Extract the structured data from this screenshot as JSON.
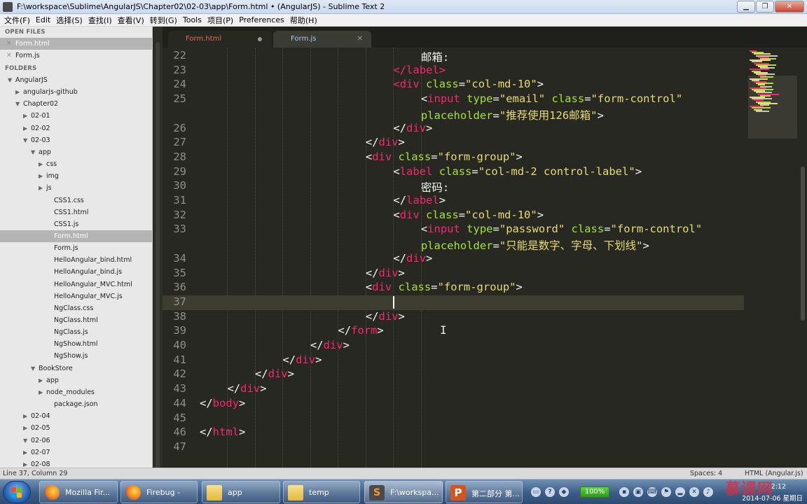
{
  "window": {
    "title": "F:\\workspace\\Sublime\\AngularJS\\Chapter02\\02-03\\app\\Form.html • (AngularJS) - Sublime Text 2",
    "min_label": "▁",
    "max_label": "❐",
    "close_label": "✕"
  },
  "menu": [
    "文件(F)",
    "Edit",
    "选择(S)",
    "查找(I)",
    "查看(V)",
    "转到(G)",
    "Tools",
    "项目(P)",
    "Preferences",
    "帮助(H)"
  ],
  "sidebar": {
    "open_files_header": "OPEN FILES",
    "open_files": [
      {
        "label": "Form.html",
        "selected": true
      },
      {
        "label": "Form.js",
        "selected": false
      }
    ],
    "folders_header": "FOLDERS",
    "tree": [
      {
        "label": "AngularJS",
        "depth": 0,
        "arrow": "▼"
      },
      {
        "label": "angularjs-github",
        "depth": 1,
        "arrow": "▶"
      },
      {
        "label": "Chapter02",
        "depth": 1,
        "arrow": "▼"
      },
      {
        "label": "02-01",
        "depth": 2,
        "arrow": "▶"
      },
      {
        "label": "02-02",
        "depth": 2,
        "arrow": "▶"
      },
      {
        "label": "02-03",
        "depth": 2,
        "arrow": "▼"
      },
      {
        "label": "app",
        "depth": 3,
        "arrow": "▼"
      },
      {
        "label": "css",
        "depth": 4,
        "arrow": "▶"
      },
      {
        "label": "img",
        "depth": 4,
        "arrow": "▶"
      },
      {
        "label": "js",
        "depth": 4,
        "arrow": "▶"
      },
      {
        "label": "CSS1.css",
        "depth": 5,
        "arrow": ""
      },
      {
        "label": "CSS1.html",
        "depth": 5,
        "arrow": ""
      },
      {
        "label": "CSS1.js",
        "depth": 5,
        "arrow": ""
      },
      {
        "label": "Form.html",
        "depth": 5,
        "arrow": "",
        "selected": true
      },
      {
        "label": "Form.js",
        "depth": 5,
        "arrow": ""
      },
      {
        "label": "HelloAngular_bind.html",
        "depth": 5,
        "arrow": ""
      },
      {
        "label": "HelloAngular_bind.js",
        "depth": 5,
        "arrow": ""
      },
      {
        "label": "HelloAngular_MVC.html",
        "depth": 5,
        "arrow": ""
      },
      {
        "label": "HelloAngular_MVC.js",
        "depth": 5,
        "arrow": ""
      },
      {
        "label": "NgClass.css",
        "depth": 5,
        "arrow": ""
      },
      {
        "label": "NgClass.html",
        "depth": 5,
        "arrow": ""
      },
      {
        "label": "NgClass.js",
        "depth": 5,
        "arrow": ""
      },
      {
        "label": "NgShow.html",
        "depth": 5,
        "arrow": ""
      },
      {
        "label": "NgShow.js",
        "depth": 5,
        "arrow": ""
      },
      {
        "label": "BookStore",
        "depth": 3,
        "arrow": "▼"
      },
      {
        "label": "app",
        "depth": 4,
        "arrow": "▶"
      },
      {
        "label": "node_modules",
        "depth": 4,
        "arrow": "▶"
      },
      {
        "label": "package.json",
        "depth": 5,
        "arrow": ""
      },
      {
        "label": "02-04",
        "depth": 2,
        "arrow": "▶"
      },
      {
        "label": "02-05",
        "depth": 2,
        "arrow": "▶"
      },
      {
        "label": "02-06",
        "depth": 2,
        "arrow": "▼"
      },
      {
        "label": "02-07",
        "depth": 2,
        "arrow": "▶"
      },
      {
        "label": "02-08",
        "depth": 2,
        "arrow": "▶"
      }
    ]
  },
  "tabs": [
    {
      "label": "Form.html",
      "active": true,
      "dirty": true
    },
    {
      "label": "Form.js",
      "active": false,
      "dirty": false
    }
  ],
  "editor": {
    "current_line": 37,
    "lines": [
      {
        "num": "22",
        "indent": 8,
        "tokens": [
          [
            "t",
            "邮箱:"
          ]
        ]
      },
      {
        "num": "23",
        "indent": 7,
        "tokens": [
          [
            "g",
            "</"
          ],
          [
            "g",
            "label"
          ],
          [
            "g",
            ">"
          ]
        ]
      },
      {
        "num": "24",
        "indent": 7,
        "tokens": [
          [
            "g",
            "<"
          ],
          [
            "g",
            "div"
          ],
          [
            "a",
            " class"
          ],
          [
            "t",
            "="
          ],
          [
            "s",
            "\"col-md-10\""
          ],
          [
            "t",
            ">"
          ]
        ]
      },
      {
        "num": "25",
        "indent": 8,
        "tokens": [
          [
            "t",
            "<"
          ],
          [
            "g",
            "input"
          ],
          [
            "a",
            " type"
          ],
          [
            "t",
            "="
          ],
          [
            "s",
            "\"email\""
          ],
          [
            "a",
            " class"
          ],
          [
            "t",
            "="
          ],
          [
            "s",
            "\"form-control\""
          ]
        ]
      },
      {
        "num": "",
        "indent": 8,
        "tokens": [
          [
            "a",
            "placeholder"
          ],
          [
            "t",
            "="
          ],
          [
            "s",
            "\"推荐使用126邮箱\""
          ],
          [
            "t",
            ">"
          ]
        ]
      },
      {
        "num": "26",
        "indent": 7,
        "tokens": [
          [
            "t",
            "</"
          ],
          [
            "g",
            "div"
          ],
          [
            "t",
            ">"
          ]
        ]
      },
      {
        "num": "27",
        "indent": 6,
        "tokens": [
          [
            "t",
            "</"
          ],
          [
            "g",
            "div"
          ],
          [
            "t",
            ">"
          ]
        ]
      },
      {
        "num": "28",
        "indent": 6,
        "tokens": [
          [
            "t",
            "<"
          ],
          [
            "g",
            "div"
          ],
          [
            "a",
            " class"
          ],
          [
            "t",
            "="
          ],
          [
            "s",
            "\"form-group\""
          ],
          [
            "t",
            ">"
          ]
        ]
      },
      {
        "num": "29",
        "indent": 7,
        "tokens": [
          [
            "t",
            "<"
          ],
          [
            "g",
            "label"
          ],
          [
            "a",
            " class"
          ],
          [
            "t",
            "="
          ],
          [
            "s",
            "\"col-md-2 control-label\""
          ],
          [
            "t",
            ">"
          ]
        ]
      },
      {
        "num": "30",
        "indent": 8,
        "tokens": [
          [
            "t",
            "密码:"
          ]
        ]
      },
      {
        "num": "31",
        "indent": 7,
        "tokens": [
          [
            "t",
            "</"
          ],
          [
            "g",
            "label"
          ],
          [
            "t",
            ">"
          ]
        ]
      },
      {
        "num": "32",
        "indent": 7,
        "tokens": [
          [
            "t",
            "<"
          ],
          [
            "g",
            "div"
          ],
          [
            "a",
            " class"
          ],
          [
            "t",
            "="
          ],
          [
            "s",
            "\"col-md-10\""
          ],
          [
            "t",
            ">"
          ]
        ]
      },
      {
        "num": "33",
        "indent": 8,
        "tokens": [
          [
            "t",
            "<"
          ],
          [
            "g",
            "input"
          ],
          [
            "a",
            " type"
          ],
          [
            "t",
            "="
          ],
          [
            "s",
            "\"password\""
          ],
          [
            "a",
            " class"
          ],
          [
            "t",
            "="
          ],
          [
            "s",
            "\"form-control\""
          ]
        ]
      },
      {
        "num": "",
        "indent": 8,
        "tokens": [
          [
            "a",
            "placeholder"
          ],
          [
            "t",
            "="
          ],
          [
            "s",
            "\"只能是数字、字母、下划线\""
          ],
          [
            "t",
            ">"
          ]
        ]
      },
      {
        "num": "34",
        "indent": 7,
        "tokens": [
          [
            "t",
            "</"
          ],
          [
            "g",
            "div"
          ],
          [
            "t",
            ">"
          ]
        ]
      },
      {
        "num": "35",
        "indent": 6,
        "tokens": [
          [
            "t",
            "</"
          ],
          [
            "g",
            "div"
          ],
          [
            "t",
            ">"
          ]
        ]
      },
      {
        "num": "36",
        "indent": 6,
        "tokens": [
          [
            "t",
            "<"
          ],
          [
            "g",
            "div"
          ],
          [
            "a",
            " class"
          ],
          [
            "t",
            "="
          ],
          [
            "s",
            "\"form-group\""
          ],
          [
            "t",
            ">"
          ]
        ]
      },
      {
        "num": "37",
        "indent": 7,
        "tokens": []
      },
      {
        "num": "38",
        "indent": 6,
        "tokens": [
          [
            "t",
            "</"
          ],
          [
            "g",
            "div"
          ],
          [
            "t",
            ">"
          ]
        ]
      },
      {
        "num": "39",
        "indent": 5,
        "tokens": [
          [
            "t",
            "</"
          ],
          [
            "g",
            "form"
          ],
          [
            "t",
            ">"
          ]
        ]
      },
      {
        "num": "40",
        "indent": 4,
        "tokens": [
          [
            "t",
            "</"
          ],
          [
            "g",
            "div"
          ],
          [
            "t",
            ">"
          ]
        ]
      },
      {
        "num": "41",
        "indent": 3,
        "tokens": [
          [
            "t",
            "</"
          ],
          [
            "g",
            "div"
          ],
          [
            "t",
            ">"
          ]
        ]
      },
      {
        "num": "42",
        "indent": 2,
        "tokens": [
          [
            "t",
            "</"
          ],
          [
            "g",
            "div"
          ],
          [
            "t",
            ">"
          ]
        ]
      },
      {
        "num": "43",
        "indent": 1,
        "tokens": [
          [
            "t",
            "</"
          ],
          [
            "g",
            "div"
          ],
          [
            "t",
            ">"
          ]
        ]
      },
      {
        "num": "44",
        "indent": 0,
        "tokens": [
          [
            "t",
            "</"
          ],
          [
            "g",
            "body"
          ],
          [
            "t",
            ">"
          ]
        ]
      },
      {
        "num": "45",
        "indent": 0,
        "tokens": []
      },
      {
        "num": "46",
        "indent": 0,
        "tokens": [
          [
            "t",
            "</"
          ],
          [
            "g",
            "html"
          ],
          [
            "t",
            ">"
          ]
        ]
      },
      {
        "num": "47",
        "indent": 0,
        "tokens": []
      }
    ]
  },
  "statusbar": {
    "position": "Line 37, Column 29",
    "spaces": "Spaces: 4",
    "syntax": "HTML (Angular.js)"
  },
  "taskbar": {
    "buttons": [
      {
        "label": "Mozilla Fir...",
        "icon": "firefox-icon"
      },
      {
        "label": "Firebug -",
        "icon": "firefox-icon"
      },
      {
        "label": "app",
        "icon": "folder-icon"
      },
      {
        "label": "temp",
        "icon": "folder-icon"
      },
      {
        "label": "F:\\workspa...",
        "icon": "sublime-icon",
        "active": true
      },
      {
        "label": "第二部分 第...",
        "icon": "powerpoint-icon"
      }
    ],
    "battery": "100%",
    "clock_time": "2:12",
    "clock_date": "2014-07-06 星期日"
  },
  "watermark": "慕课网",
  "colors": {
    "editor_bg": "#272822",
    "tag": "#f92672",
    "attr": "#a6e22e",
    "string": "#e6db74",
    "text": "#f8f8f2"
  }
}
